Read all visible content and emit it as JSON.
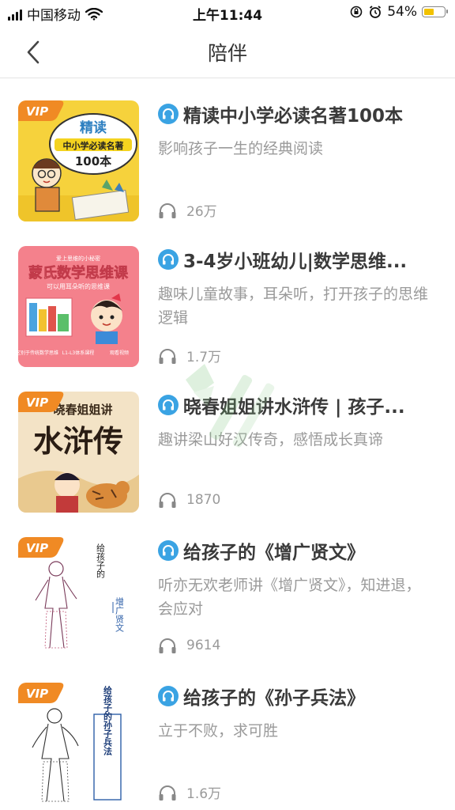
{
  "status_bar": {
    "carrier": "中国移动",
    "time": "上午11:44",
    "battery_percent": "54%",
    "battery_level": 0.54
  },
  "nav": {
    "title": "陪伴",
    "back_icon": "chevron-left-icon"
  },
  "items": [
    {
      "title": "精读中小学必读名著100本",
      "subtitle": "影响孩子一生的经典阅读",
      "plays": "26万",
      "vip": true,
      "badge": "VIP",
      "cover_text": [
        "精读",
        "中小学必读名著",
        "100本"
      ]
    },
    {
      "title": "3-4岁小班幼儿|数学思维...",
      "subtitle": "趣味儿童故事，耳朵听，打开孩子的思维逻辑",
      "plays": "1.7万",
      "vip": false,
      "cover_text": [
        "爱上思维的小秘密",
        "蒙氏数学思维课",
        "可以用耳朵听的思维课",
        "区别于传统数学思维",
        "L1-L3体系课程",
        "观看视频"
      ]
    },
    {
      "title": "晓春姐姐讲水浒传 | 孩子...",
      "subtitle": "趣讲梁山好汉传奇，感悟成长真谛",
      "plays": "1870",
      "vip": true,
      "badge": "VIP",
      "cover_text": [
        "晓春姐姐讲",
        "水浒传"
      ]
    },
    {
      "title": "给孩子的《增广贤文》",
      "subtitle": "听亦无欢老师讲《增广贤文》，知进退，会应对",
      "plays": "9614",
      "vip": true,
      "badge": "VIP",
      "cover_text": [
        "给孩子的",
        "增广贤文"
      ]
    },
    {
      "title": "给孩子的《孙子兵法》",
      "subtitle": "立于不败，求可胜",
      "plays": "1.6万",
      "vip": true,
      "badge": "VIP",
      "cover_text": [
        "给孩子的孙子兵法"
      ]
    }
  ],
  "colors": {
    "audio_badge": "#3aa3e3",
    "vip_badge": "#f08a24",
    "subtitle": "#9a9a9a"
  }
}
